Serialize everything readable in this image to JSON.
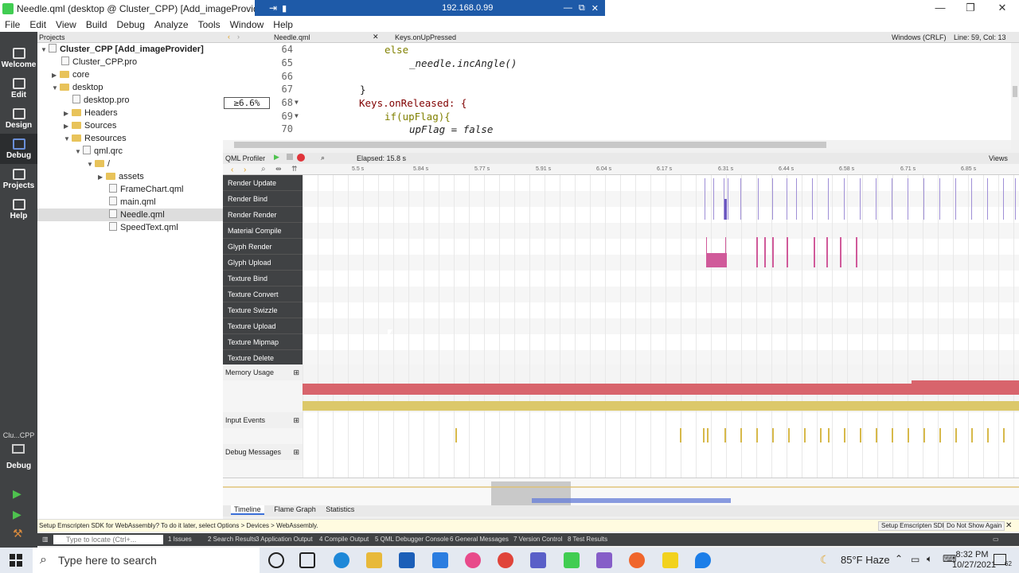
{
  "titlebar": {
    "title": "Needle.qml (desktop @ Cluster_CPP) [Add_imageProvider] - Qt Creator",
    "remote_ip": "192.168.0.99"
  },
  "menu": [
    "File",
    "Edit",
    "View",
    "Build",
    "Debug",
    "Analyze",
    "Tools",
    "Window",
    "Help"
  ],
  "modes": [
    {
      "label": "Welcome",
      "icon": "grid-icon"
    },
    {
      "label": "Edit",
      "icon": "document-icon"
    },
    {
      "label": "Design",
      "icon": "pen-icon"
    },
    {
      "label": "Debug",
      "icon": "bug-icon"
    },
    {
      "label": "Projects",
      "icon": "wrench-icon"
    },
    {
      "label": "Help",
      "icon": "question-icon"
    }
  ],
  "kit": {
    "name": "Clu...CPP",
    "label": "Debug"
  },
  "projects": {
    "header": "Projects",
    "tree": [
      {
        "label": "Cluster_CPP [Add_imageProvider]",
        "bold": true
      },
      {
        "label": "Cluster_CPP.pro"
      },
      {
        "label": "core"
      },
      {
        "label": "desktop"
      },
      {
        "label": "desktop.pro"
      },
      {
        "label": "Headers"
      },
      {
        "label": "Sources"
      },
      {
        "label": "Resources"
      },
      {
        "label": "qml.qrc"
      },
      {
        "label": "/"
      },
      {
        "label": "assets"
      },
      {
        "label": "FrameChart.qml"
      },
      {
        "label": "main.qml"
      },
      {
        "label": "Needle.qml"
      },
      {
        "label": "SpeedText.qml"
      }
    ]
  },
  "editor": {
    "file_tab": "Needle.qml",
    "symbol": "Keys.onUpPressed",
    "line_ending": "Windows (CRLF)",
    "position": "Line: 59, Col: 13",
    "annotation": "≥6.6%",
    "lines": [
      {
        "num": "64",
        "text": "else"
      },
      {
        "num": "65",
        "text": "_needle.incAngle()"
      },
      {
        "num": "66",
        "text": ""
      },
      {
        "num": "67",
        "text": "}"
      },
      {
        "num": "68",
        "text": "Keys.onReleased: {"
      },
      {
        "num": "69",
        "text": "if(upFlag){"
      },
      {
        "num": "70",
        "text": "upFlag = false"
      }
    ]
  },
  "profiler": {
    "title": "QML Profiler",
    "elapsed": "Elapsed:  15.8 s",
    "views": "Views",
    "ruler": [
      "5.5 s",
      "5.84 s",
      "5.77 s",
      "5.91 s",
      "6.04 s",
      "6.17 s",
      "6.31 s",
      "6.44 s",
      "6.58 s",
      "6.71 s",
      "6.85 s"
    ],
    "rows": [
      "Render Update",
      "Render Bind",
      "Render Render",
      "Material Compile",
      "Glyph Render",
      "Glyph Upload",
      "Texture Bind",
      "Texture Convert",
      "Texture Swizzle",
      "Texture Upload",
      "Texture Mipmap",
      "Texture Delete"
    ],
    "categories": [
      "Memory Usage",
      "Input Events",
      "Debug Messages"
    ],
    "tabs": [
      "Timeline",
      "Flame Graph",
      "Statistics"
    ]
  },
  "infobar": {
    "message": "Setup Emscripten SDK for WebAssembly? To do it later, select Options > Devices > WebAssembly.",
    "setup_button": "Setup Emscripten SDK",
    "dismiss_button": "Do Not Show Again"
  },
  "output_panes": [
    "1  Issues",
    "2  Search Results",
    "3  Application Output",
    "4  Compile Output",
    "5  QML Debugger Console",
    "6  General Messages",
    "7  Version Control",
    "8  Test Results"
  ],
  "locator_placeholder": "Type to locate (Ctrl+...",
  "taskbar": {
    "search_placeholder": "Type here to search",
    "weather": "85°F  Haze",
    "time": "8:32 PM",
    "date": "10/27/2021",
    "notifications": "62"
  },
  "colors": {
    "modebar": "#404244",
    "glyph": "#d05a9a",
    "memory": "#d8646c",
    "memory2": "#dcc86a",
    "input": "#d7b94a",
    "render": "#9f8fd6"
  }
}
